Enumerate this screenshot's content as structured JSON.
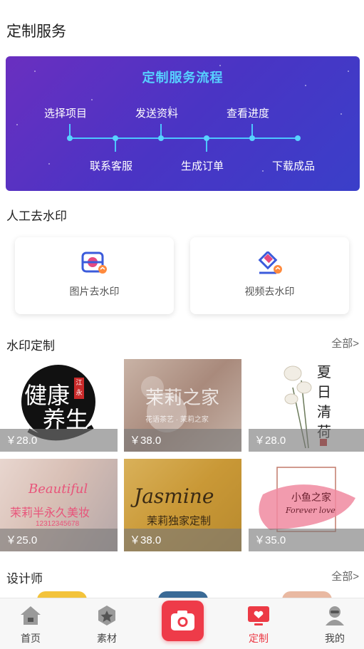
{
  "page": {
    "title": "定制服务"
  },
  "flow": {
    "title": "定制服务流程",
    "steps_top": [
      "选择项目",
      "发送资料",
      "查看进度"
    ],
    "steps_bottom": [
      "联系客服",
      "生成订单",
      "下载成品"
    ]
  },
  "watermark_removal": {
    "title": "人工去水印",
    "cards": [
      {
        "label": "图片去水印",
        "icon": "image-remove-icon"
      },
      {
        "label": "视频去水印",
        "icon": "eraser-icon"
      }
    ]
  },
  "watermark_custom": {
    "title": "水印定制",
    "see_all": "全部>",
    "tiles": [
      {
        "price": "￥28.0",
        "art_text": [
          "健康",
          "养生"
        ],
        "seal": "江永"
      },
      {
        "price": "￥38.0",
        "art_text": [
          "茉莉之家"
        ],
        "sub": "花语茶艺 · 茉莉之家"
      },
      {
        "price": "￥28.0",
        "art_text": [
          "夏日清荷"
        ]
      },
      {
        "price": "￥25.0",
        "art_text": [
          "Beautiful",
          "茉莉半永久美妆",
          "12312345678"
        ]
      },
      {
        "price": "￥38.0",
        "art_text": [
          "Jasmine",
          "茉莉独家定制"
        ]
      },
      {
        "price": "￥35.0",
        "art_text": [
          "小鱼之家",
          "Forever love"
        ]
      }
    ]
  },
  "designers": {
    "title": "设计师",
    "see_all": "全部>"
  },
  "tabbar": {
    "tabs": [
      {
        "label": "首页",
        "icon": "home-icon"
      },
      {
        "label": "素材",
        "icon": "star-box-icon"
      },
      {
        "label": "",
        "icon": "camera-icon"
      },
      {
        "label": "定制",
        "icon": "tv-heart-icon"
      },
      {
        "label": "我的",
        "icon": "user-icon"
      }
    ],
    "active_color": "#ec3a45"
  },
  "colors": {
    "banner_start": "#6a2fc0",
    "banner_end": "#3a3fc9",
    "accent": "#ee3b49",
    "flow_line": "#4cc6ff"
  }
}
